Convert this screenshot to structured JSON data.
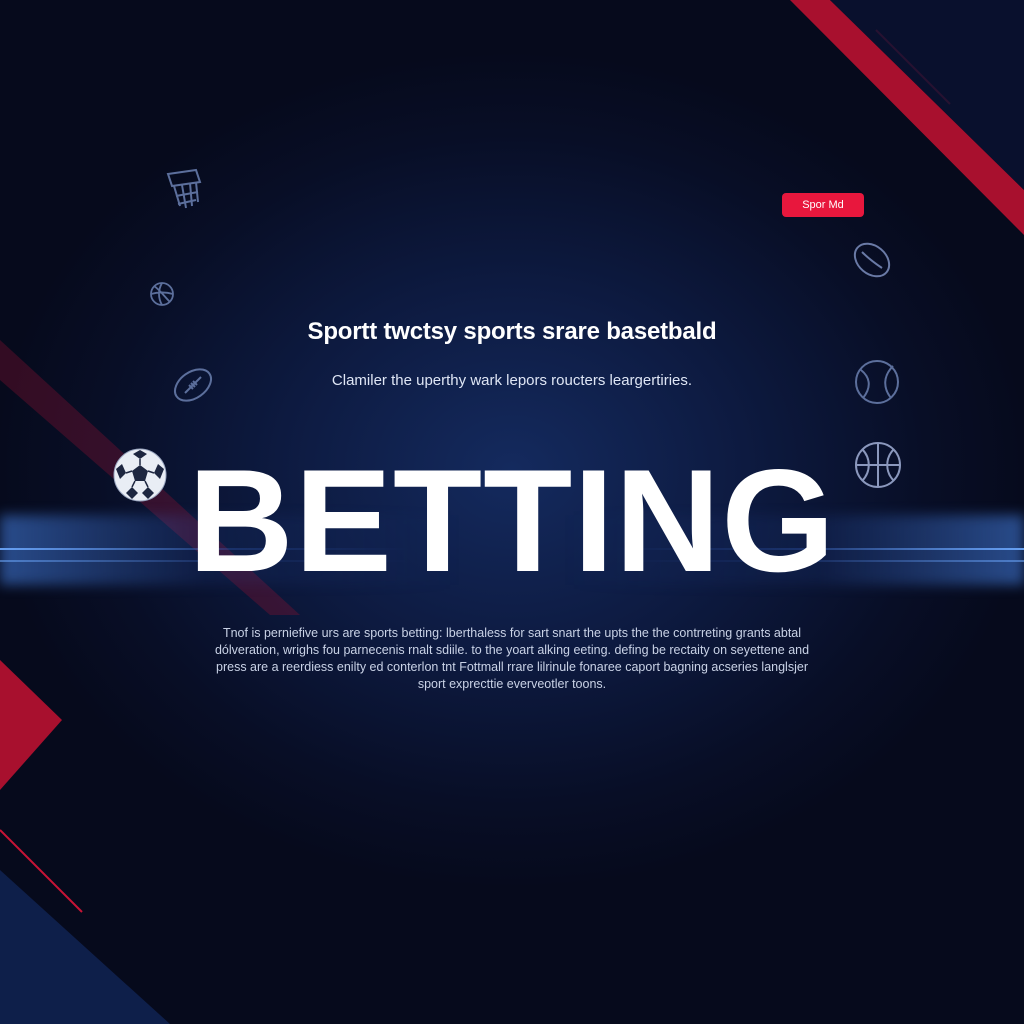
{
  "badge": {
    "label": "Spor Md"
  },
  "headline": "Sportt twctsy sports srare basetbald",
  "subheadline": "Clamiler the uperthy wark lepors roucters leargertiries.",
  "hero_word": "BETTING",
  "body_lines": [
    "Tnof is perniefive urs are sports betting: lberthaless for sart snart the upts the the contrreting grants abtal",
    "dólveration, wrighs fou parnecenis rnalt sdiile. to the yoart alking eeting. defing be rectaity on seyettene and",
    "press are a reerdiess enilty ed conterlon tnt Fottmall rrare lilrinule fonaree caport bagning acseries langlsjer",
    "sport exprecttie everveotler toons."
  ],
  "icons": [
    "basketball-hoop-icon",
    "volleyball-icon",
    "football-icon",
    "soccer-ball-icon",
    "rugby-ball-icon",
    "tennis-ball-icon",
    "basketball-icon"
  ],
  "colors": {
    "background": "#070b1f",
    "accent_red": "#e8173d",
    "deep_red": "#a8102e",
    "glow_blue": "#4682e6",
    "text": "#ffffff"
  }
}
